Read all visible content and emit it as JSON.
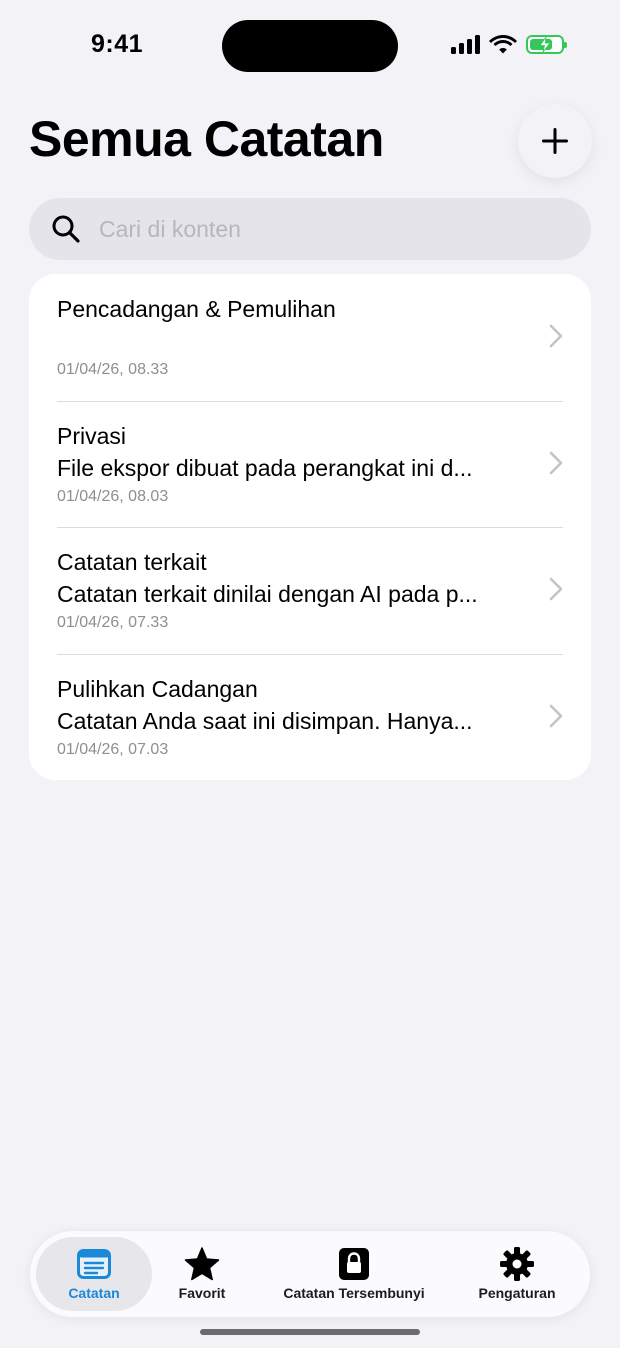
{
  "status_bar": {
    "time": "9:41"
  },
  "header": {
    "title": "Semua Catatan",
    "add_icon": "plus-icon"
  },
  "search": {
    "placeholder": "Cari di konten",
    "value": ""
  },
  "notes": [
    {
      "title": "Pencadangan & Pemulihan",
      "preview": "",
      "date": "01/04/26, 08.33"
    },
    {
      "title": "Privasi",
      "preview": "File ekspor dibuat pada perangkat ini d...",
      "date": "01/04/26, 08.03"
    },
    {
      "title": "Catatan terkait",
      "preview": "Catatan terkait dinilai dengan AI pada p...",
      "date": "01/04/26, 07.33"
    },
    {
      "title": "Pulihkan Cadangan",
      "preview": "Catatan Anda saat ini disimpan. Hanya...",
      "date": "01/04/26, 07.03"
    }
  ],
  "tabs": [
    {
      "label": "Catatan",
      "icon": "notes-icon",
      "active": true
    },
    {
      "label": "Favorit",
      "icon": "star-icon",
      "active": false
    },
    {
      "label": "Catatan Tersembunyi",
      "icon": "lock-icon",
      "active": false
    },
    {
      "label": "Pengaturan",
      "icon": "gear-icon",
      "active": false
    }
  ],
  "colors": {
    "accent": "#1a8ad8",
    "background": "#f2f2f7",
    "battery": "#34c759"
  }
}
